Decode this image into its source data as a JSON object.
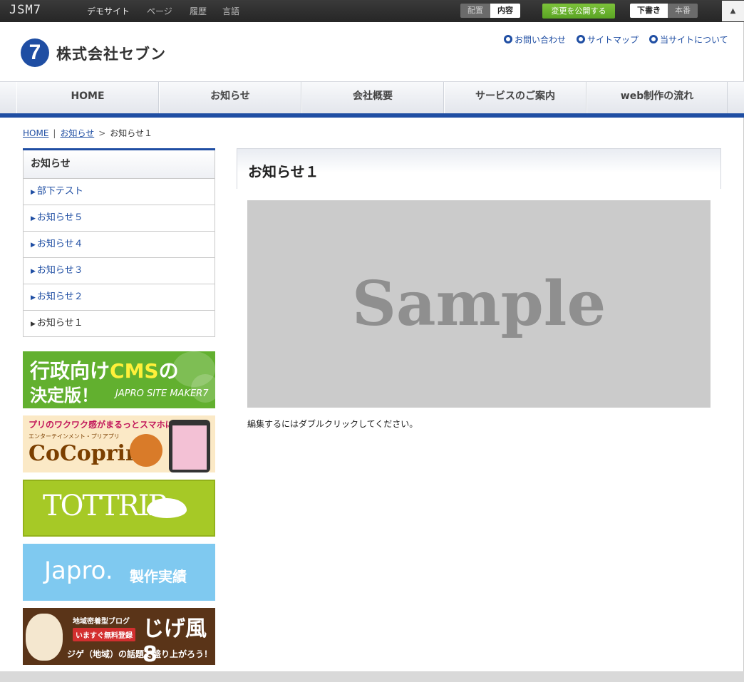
{
  "admin": {
    "logo": "JSM7",
    "menu": [
      "デモサイト",
      "ページ",
      "履歴",
      "言語"
    ],
    "mode_toggle": [
      "配置",
      "内容"
    ],
    "publish_label": "変更を公開する",
    "version_toggle": [
      "下書き",
      "本番"
    ],
    "collapse_icon": "▲"
  },
  "site": {
    "logo_mark": "7",
    "company_name": "株式会社セブン",
    "top_links": [
      "お問い合わせ",
      "サイトマップ",
      "当サイトについて"
    ]
  },
  "gnav": [
    "HOME",
    "お知らせ",
    "会社概要",
    "サービスのご案内",
    "web制作の流れ"
  ],
  "breadcrumb": {
    "links": [
      "HOME",
      "お知らせ"
    ],
    "separator_1": "|",
    "separator_2": ">",
    "current": "お知らせ１"
  },
  "side_menu": {
    "title": "お知らせ",
    "items": [
      "部下テスト",
      "お知らせ５",
      "お知らせ４",
      "お知らせ３",
      "お知らせ２",
      "お知らせ１"
    ],
    "current_index": 5
  },
  "banners": {
    "cms": {
      "line1_a": "行政向け",
      "line1_b": "CMS",
      "line1_c": "の",
      "line2": "決定版！",
      "sub": "JAPRO SITE MAKER7"
    },
    "cocoprin": {
      "headline": "プリのワクワク感がまるっとスマホに♥",
      "sub": "エンターテインメント・プリアプリ",
      "logo": "CoCoprin"
    },
    "tottrip": {
      "logo": "TOTTRIP"
    },
    "japro": {
      "logo": "Japro.",
      "label": "製作実績"
    },
    "jigekaze": {
      "tag": "地域密着型ブログ",
      "cta": "いますぐ無料登録",
      "logo": "じげ風8",
      "tagline": "ジゲ（地域）の話題で盛り上がろう！"
    }
  },
  "main": {
    "title": "お知らせ１",
    "image_text": "Sample",
    "note": "編集するにはダブルクリックしてください。"
  },
  "colors": {
    "brand_blue": "#1f4ea3",
    "publish_green": "#5aa423",
    "admin_bar": "#2e2e2e"
  }
}
